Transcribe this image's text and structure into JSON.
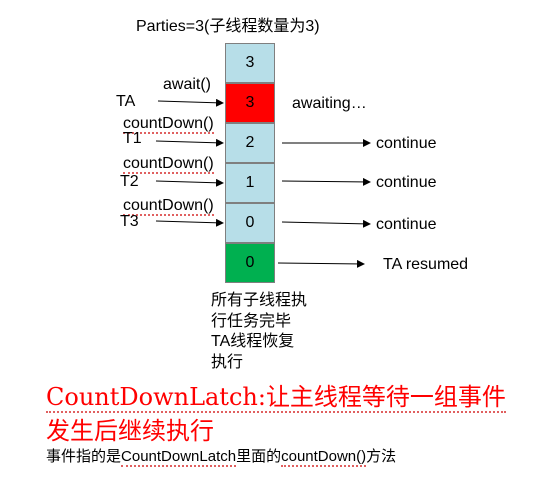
{
  "title": "Parties=3(子线程数量为3)",
  "cells": [
    "3",
    "3",
    "2",
    "1",
    "0",
    "0"
  ],
  "left_labels": {
    "await": "await()",
    "ta": "TA",
    "countdown": "countDown()",
    "t1": "T1",
    "t2": "T2",
    "t3": "T3"
  },
  "right_labels": {
    "awaiting": "awaiting…",
    "continue": "continue",
    "ta_resumed": "TA resumed"
  },
  "bottom_note": [
    "所有子线程执",
    "行任务完毕",
    "TA线程恢复",
    "执行"
  ],
  "heading_lines": [
    "CountDownLatch:让主线程等待一组事件",
    "发生后继续执行"
  ],
  "footer": {
    "prefix": "事件指的是",
    "class_name": "CountDownLatch",
    "middle": "里面的",
    "method": "countDown()",
    "suffix": "方法"
  },
  "colors": {
    "cell_blue": "#b7dee8",
    "cell_red": "#ff0000",
    "cell_green": "#00b050",
    "heading": "#ff0000"
  }
}
